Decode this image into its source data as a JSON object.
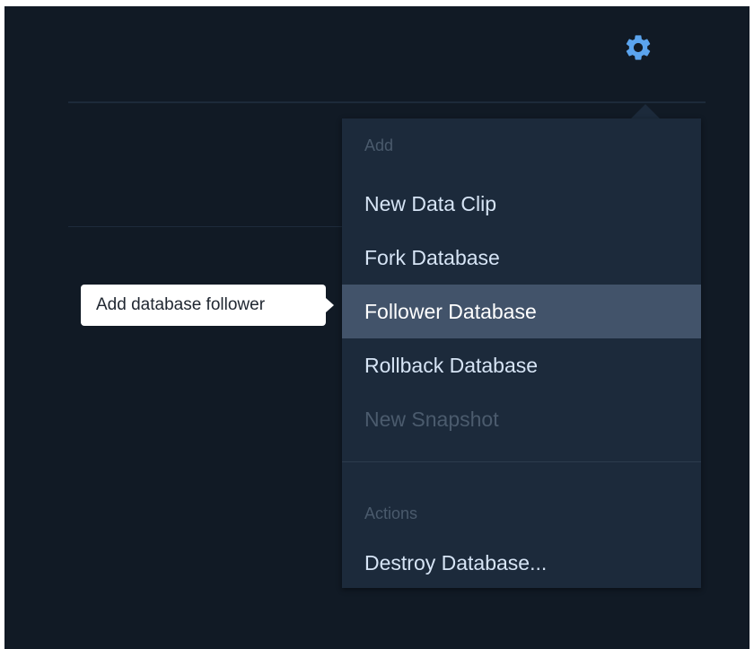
{
  "gear": {
    "icon": "gear-icon",
    "color": "#5ba4ee"
  },
  "menu": {
    "add_header": "Add",
    "items": [
      {
        "label": "New Data Clip",
        "state": "enabled"
      },
      {
        "label": "Fork Database",
        "state": "enabled"
      },
      {
        "label": "Follower Database",
        "state": "highlighted"
      },
      {
        "label": "Rollback Database",
        "state": "enabled"
      },
      {
        "label": "New Snapshot",
        "state": "disabled"
      }
    ],
    "actions_header": "Actions",
    "actions": [
      {
        "label": "Destroy Database...",
        "state": "enabled"
      }
    ]
  },
  "tooltip": {
    "text": "Add database follower"
  },
  "colors": {
    "background": "#111a25",
    "menu_background": "#1c2a3b",
    "highlight": "#42536a",
    "accent": "#5ba4ee"
  }
}
